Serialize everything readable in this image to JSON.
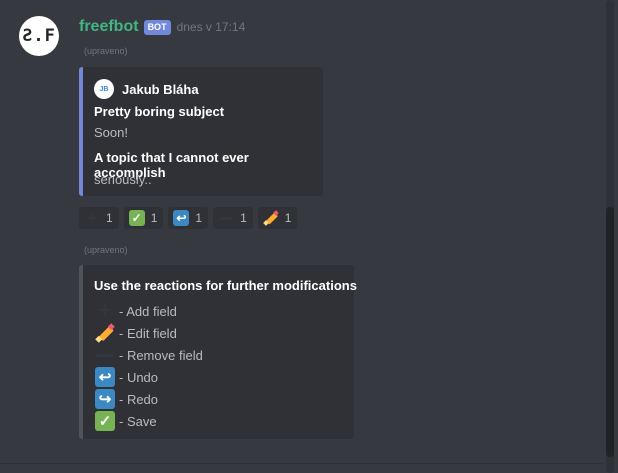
{
  "message": {
    "avatar_text": "Ƨ.F",
    "username": "freefbot",
    "bot_tag": "BOT",
    "timestamp": "dnes v 17:14",
    "edited_label_1": "(upraveno)",
    "edited_label_2": "(upraveno)"
  },
  "embed1": {
    "author": {
      "name": "Jakub Bláha",
      "icon_text": "JB"
    },
    "accent_color": "#7289da",
    "fields": [
      {
        "name": "Pretty boring subject",
        "value": "Soon!"
      },
      {
        "name": "A topic that I cannot ever accomplish",
        "value": "seriously.."
      }
    ]
  },
  "reactions": [
    {
      "icon": "heavy-plus-icon",
      "count": "1"
    },
    {
      "icon": "check-mark-icon",
      "count": "1"
    },
    {
      "icon": "undo-arrow-icon",
      "count": "1"
    },
    {
      "icon": "heavy-minus-icon",
      "count": "1"
    },
    {
      "icon": "pencil-icon",
      "count": "1"
    }
  ],
  "embed2": {
    "title": "Use the reactions for further modifications",
    "accent_color": "#4f545c",
    "legend": [
      {
        "icon": "heavy-plus-icon",
        "text": "- Add field"
      },
      {
        "icon": "pencil-icon",
        "text": "- Edit field"
      },
      {
        "icon": "heavy-minus-icon",
        "text": "- Remove field"
      },
      {
        "icon": "undo-arrow-icon",
        "text": "- Undo"
      },
      {
        "icon": "redo-arrow-icon",
        "text": "- Redo"
      },
      {
        "icon": "check-mark-icon",
        "text": "- Save"
      }
    ]
  },
  "colors": {
    "background": "#36393f",
    "embed_background": "#2f3136",
    "username": "#43b581",
    "bot_tag": "#7289da"
  }
}
